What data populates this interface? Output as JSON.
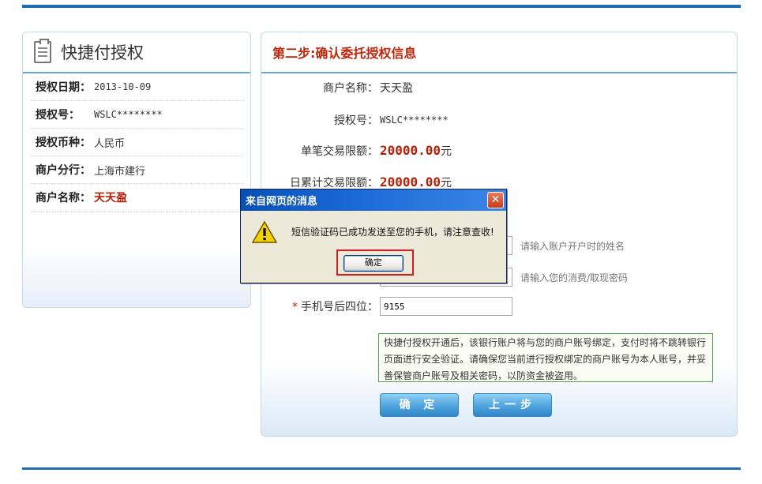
{
  "left_panel": {
    "title": "快捷付授权",
    "rows": [
      {
        "key": "授权日期：",
        "value": "2013-10-09"
      },
      {
        "key": "授权号：",
        "value": "WSLC********"
      },
      {
        "key": "授权币种：",
        "value": "人民币"
      },
      {
        "key": "商户分行：",
        "value": "上海市建行"
      },
      {
        "key": "商户名称：",
        "value": "天天盈"
      }
    ]
  },
  "right_panel": {
    "title": "第二步:确认委托授权信息",
    "merchant_label": "商户名称：",
    "merchant_value": "天天盈",
    "auth_label": "授权号：",
    "auth_value": "WSLC********",
    "single_limit_label": "单笔交易限额：",
    "single_limit_value": "20000.00",
    "daily_limit_label": "日累计交易限额：",
    "daily_limit_value": "20000.00",
    "currency_unit": "元",
    "name_hint": "请输入账户开户时的姓名",
    "password_hint": "请输入您的消费/取现密码",
    "phone_label": "手机号后四位：",
    "phone_required": "*",
    "phone_value": "9155",
    "notice": "快捷付授权开通后，该银行账户将与您的商户账号绑定，支付时将不跳转银行页面进行安全验证。请确保您当前进行授权绑定的商户账号为本人账号，并妥善保管商户账号及相关密码，以防资金被盗用。",
    "confirm_button": "确 定",
    "back_button": "上一步"
  },
  "dialog": {
    "title": "来自网页的消息",
    "close_glyph": "✕",
    "message": "短信验证码已成功发送至您的手机，请注意查收!",
    "ok_button": "确定"
  },
  "colors": {
    "brand_blue": "#1c6fb5",
    "title_red": "#c0260b",
    "amount_red": "#b81e06",
    "notice_border": "#4aa64a"
  }
}
